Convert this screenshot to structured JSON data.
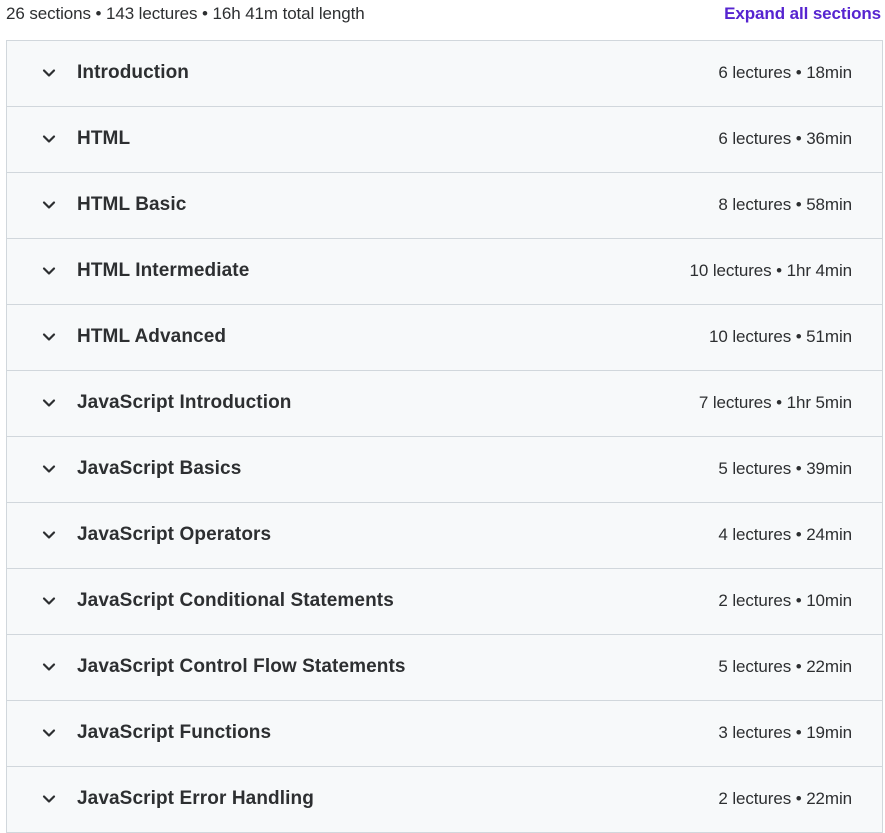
{
  "summary": {
    "text": "26 sections • 143 lectures • 16h 41m total length",
    "expand_label": "Expand all sections"
  },
  "colors": {
    "accent": "#5624d0",
    "row_bg": "#f7f9fa",
    "border": "#d1d7dc",
    "text": "#2d2f31"
  },
  "sections": [
    {
      "title": "Introduction",
      "meta": "6 lectures • 18min",
      "icon": "chevron-down-icon"
    },
    {
      "title": "HTML",
      "meta": "6 lectures • 36min",
      "icon": "chevron-down-icon"
    },
    {
      "title": "HTML Basic",
      "meta": "8 lectures • 58min",
      "icon": "chevron-down-icon"
    },
    {
      "title": "HTML Intermediate",
      "meta": "10 lectures • 1hr 4min",
      "icon": "chevron-down-icon"
    },
    {
      "title": "HTML Advanced",
      "meta": "10 lectures • 51min",
      "icon": "chevron-down-icon"
    },
    {
      "title": "JavaScript Introduction",
      "meta": "7 lectures • 1hr 5min",
      "icon": "chevron-down-icon"
    },
    {
      "title": "JavaScript Basics",
      "meta": "5 lectures • 39min",
      "icon": "chevron-down-icon"
    },
    {
      "title": "JavaScript Operators",
      "meta": "4 lectures • 24min",
      "icon": "chevron-down-icon"
    },
    {
      "title": "JavaScript Conditional Statements",
      "meta": "2 lectures • 10min",
      "icon": "chevron-down-icon"
    },
    {
      "title": "JavaScript Control Flow Statements",
      "meta": "5 lectures • 22min",
      "icon": "chevron-down-icon"
    },
    {
      "title": "JavaScript Functions",
      "meta": "3 lectures • 19min",
      "icon": "chevron-down-icon"
    },
    {
      "title": "JavaScript Error Handling",
      "meta": "2 lectures • 22min",
      "icon": "chevron-down-icon"
    }
  ]
}
